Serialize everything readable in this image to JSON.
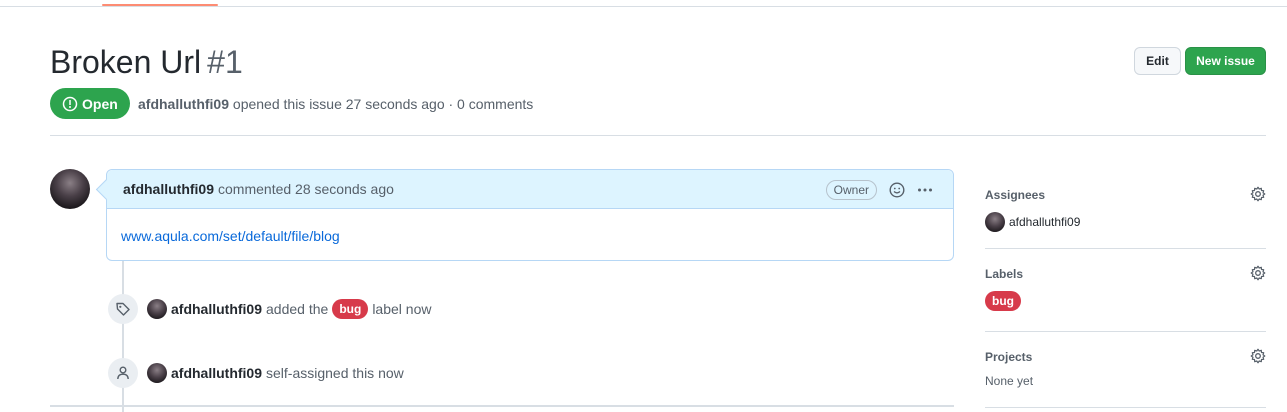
{
  "issue": {
    "title": "Broken Url",
    "number": "#1",
    "state": "Open",
    "author": "afdhalluthfi09",
    "meta_rest": "opened this issue 27 seconds ago · 0 comments"
  },
  "header_buttons": {
    "edit": "Edit",
    "new_issue": "New issue"
  },
  "comment": {
    "author": "afdhalluthfi09",
    "action": "commented 28 seconds ago",
    "role_badge": "Owner",
    "body_link": "www.aqula.com/set/default/file/blog"
  },
  "timeline": [
    {
      "icon": "tag-icon",
      "user": "afdhalluthfi09",
      "before": "added the",
      "label": "bug",
      "after": "label now"
    },
    {
      "icon": "person-icon",
      "user": "afdhalluthfi09",
      "text": "self-assigned this now"
    }
  ],
  "sidebar": {
    "assignees": {
      "title": "Assignees",
      "value": "afdhalluthfi09"
    },
    "labels": {
      "title": "Labels",
      "value": "bug"
    },
    "projects": {
      "title": "Projects",
      "value": "None yet"
    }
  },
  "colors": {
    "open_green": "#2da44e",
    "bug_red": "#d73a4a",
    "link_blue": "#0969da",
    "tab_underline": "#fd8c73"
  }
}
